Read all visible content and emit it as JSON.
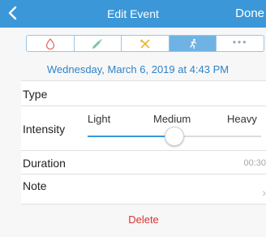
{
  "nav": {
    "back_icon": "chevron-left-icon",
    "title": "Edit Event",
    "done_label": "Done",
    "color": "#3b97d8"
  },
  "event_type_tabs": [
    {
      "icon": "drop-icon",
      "color": "#e06a6a",
      "selected": false
    },
    {
      "icon": "syringe-icon",
      "color": "#7cc3a6",
      "selected": false
    },
    {
      "icon": "food-icon",
      "color": "#e8b630",
      "selected": false
    },
    {
      "icon": "exercise-icon",
      "color": "#ffffff",
      "selected": true
    },
    {
      "icon": "more-icon",
      "label": "•••",
      "selected": false
    }
  ],
  "date_text": "Wednesday, March 6, 2019 at 4:43 PM",
  "type": {
    "label": "Type"
  },
  "intensity": {
    "label": "Intensity",
    "levels": [
      "Light",
      "Medium",
      "Heavy"
    ],
    "selected": "Medium",
    "value": 0.5
  },
  "duration": {
    "label": "Duration",
    "value": "00:30"
  },
  "note": {
    "label": "Note",
    "chevron_icon": "chevron-right-icon"
  },
  "delete_label": "Delete"
}
